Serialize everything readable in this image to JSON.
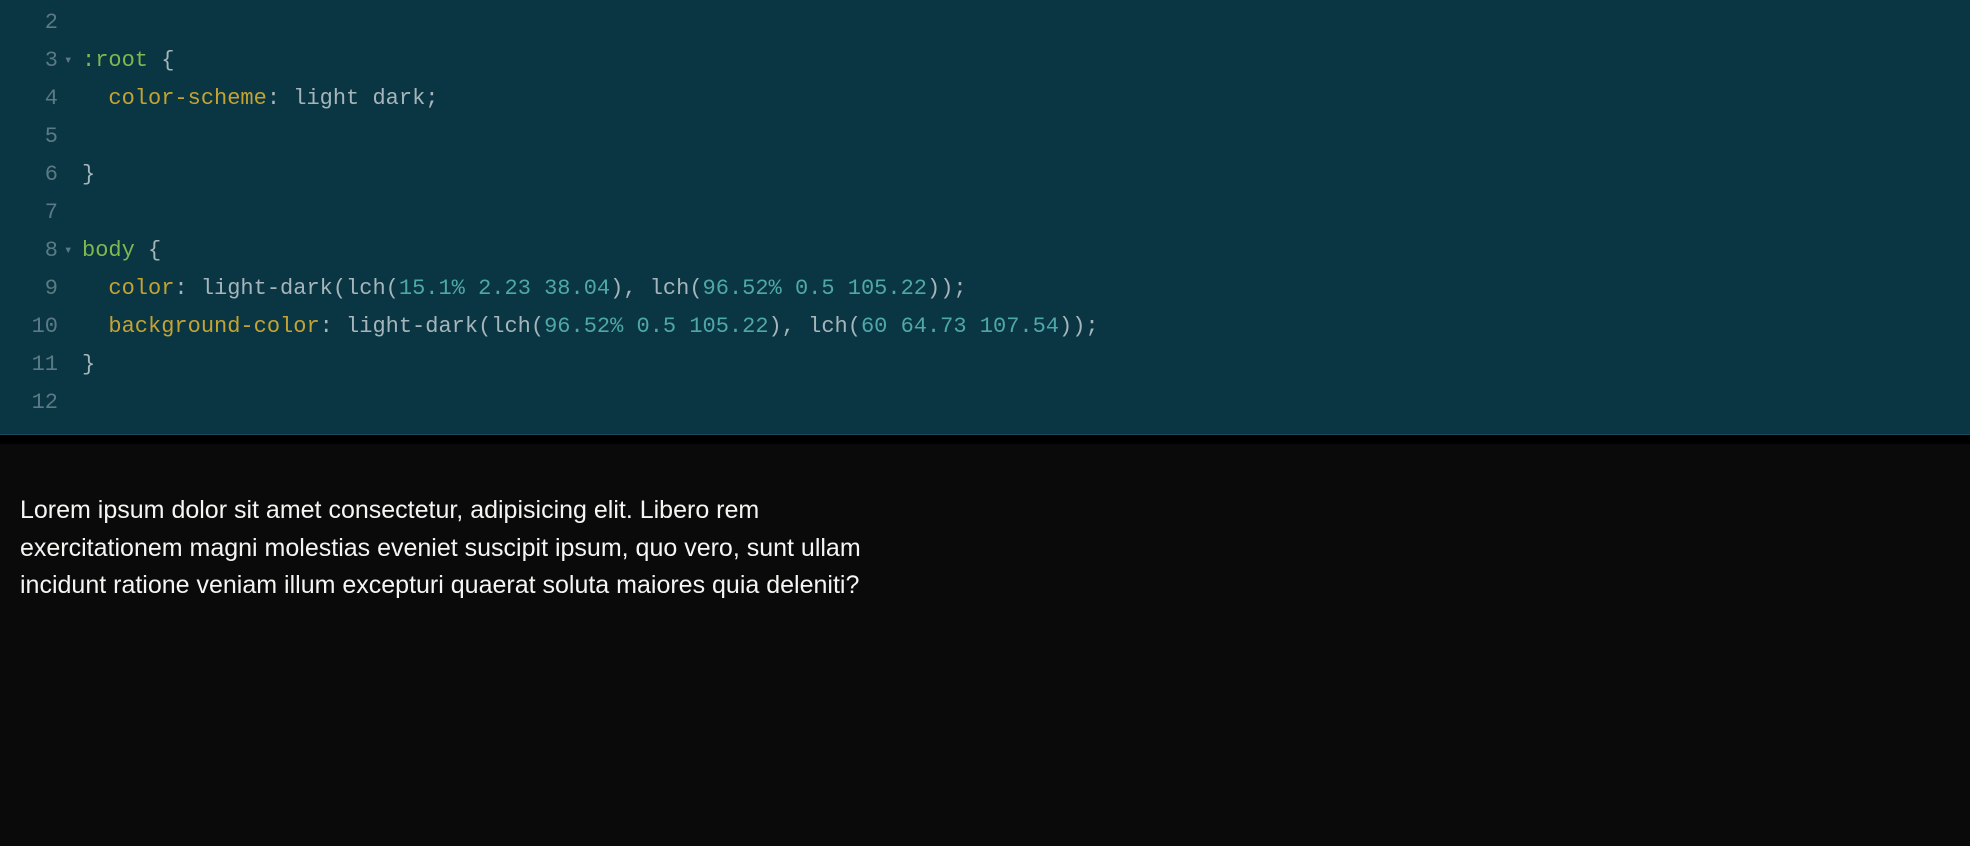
{
  "editor": {
    "lines": [
      {
        "num": "2",
        "fold": "",
        "tokens": []
      },
      {
        "num": "3",
        "fold": "▾",
        "tokens": [
          {
            "cls": "tok-selector",
            "t": ":root"
          },
          {
            "cls": "tok-punc",
            "t": " {"
          }
        ]
      },
      {
        "num": "4",
        "fold": "",
        "tokens": [
          {
            "cls": "",
            "t": "  "
          },
          {
            "cls": "tok-prop",
            "t": "color-scheme"
          },
          {
            "cls": "tok-punc",
            "t": ": "
          },
          {
            "cls": "tok-val",
            "t": "light dark"
          },
          {
            "cls": "tok-punc",
            "t": ";"
          }
        ]
      },
      {
        "num": "5",
        "fold": "",
        "tokens": [
          {
            "cls": "",
            "t": "  "
          }
        ]
      },
      {
        "num": "6",
        "fold": "",
        "tokens": [
          {
            "cls": "tok-punc",
            "t": "}"
          }
        ]
      },
      {
        "num": "7",
        "fold": "",
        "tokens": []
      },
      {
        "num": "8",
        "fold": "▾",
        "tokens": [
          {
            "cls": "tok-selector",
            "t": "body"
          },
          {
            "cls": "tok-punc",
            "t": " {"
          }
        ]
      },
      {
        "num": "9",
        "fold": "",
        "tokens": [
          {
            "cls": "",
            "t": "  "
          },
          {
            "cls": "tok-prop",
            "t": "color"
          },
          {
            "cls": "tok-punc",
            "t": ": "
          },
          {
            "cls": "tok-val",
            "t": "light-dark(lch("
          },
          {
            "cls": "tok-num",
            "t": "15.1%"
          },
          {
            "cls": "tok-val",
            "t": " "
          },
          {
            "cls": "tok-num",
            "t": "2.23"
          },
          {
            "cls": "tok-val",
            "t": " "
          },
          {
            "cls": "tok-num",
            "t": "38.04"
          },
          {
            "cls": "tok-val",
            "t": "), lch("
          },
          {
            "cls": "tok-num",
            "t": "96.52%"
          },
          {
            "cls": "tok-val",
            "t": " "
          },
          {
            "cls": "tok-num",
            "t": "0.5"
          },
          {
            "cls": "tok-val",
            "t": " "
          },
          {
            "cls": "tok-num",
            "t": "105.22"
          },
          {
            "cls": "tok-val",
            "t": "))"
          },
          {
            "cls": "tok-punc",
            "t": ";"
          }
        ]
      },
      {
        "num": "10",
        "fold": "",
        "tokens": [
          {
            "cls": "",
            "t": "  "
          },
          {
            "cls": "tok-prop",
            "t": "background-color"
          },
          {
            "cls": "tok-punc",
            "t": ": "
          },
          {
            "cls": "tok-val",
            "t": "light-dark(lch("
          },
          {
            "cls": "tok-num",
            "t": "96.52%"
          },
          {
            "cls": "tok-val",
            "t": " "
          },
          {
            "cls": "tok-num",
            "t": "0.5"
          },
          {
            "cls": "tok-val",
            "t": " "
          },
          {
            "cls": "tok-num",
            "t": "105.22"
          },
          {
            "cls": "tok-val",
            "t": "), lch("
          },
          {
            "cls": "tok-num",
            "t": "60"
          },
          {
            "cls": "tok-val",
            "t": " "
          },
          {
            "cls": "tok-num",
            "t": "64.73"
          },
          {
            "cls": "tok-val",
            "t": " "
          },
          {
            "cls": "tok-num",
            "t": "107.54"
          },
          {
            "cls": "tok-val",
            "t": "))"
          },
          {
            "cls": "tok-punc",
            "t": ";"
          }
        ]
      },
      {
        "num": "11",
        "fold": "",
        "tokens": [
          {
            "cls": "tok-punc",
            "t": "}"
          }
        ]
      },
      {
        "num": "12",
        "fold": "",
        "tokens": []
      }
    ]
  },
  "preview": {
    "text": "Lorem ipsum dolor sit amet consectetur, adipisicing elit. Libero rem exercitationem magni molestias eveniet suscipit ipsum, quo vero, sunt ullam incidunt ratione veniam illum excepturi quaerat soluta maiores quia deleniti?"
  }
}
